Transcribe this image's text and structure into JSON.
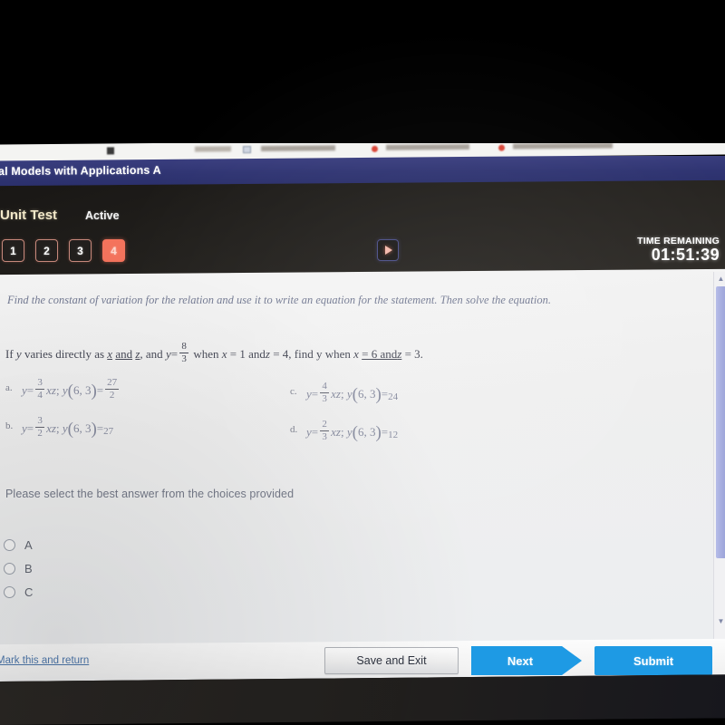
{
  "browser": {
    "bookmarks": [
      {
        "label": "",
        "type": "square"
      },
      {
        "label": "",
        "type": "text"
      },
      {
        "label": "",
        "type": "check"
      },
      {
        "label": "",
        "type": "text"
      },
      {
        "label": "",
        "type": "dot"
      },
      {
        "label": "",
        "type": "text"
      },
      {
        "label": "",
        "type": "dot"
      },
      {
        "label": "",
        "type": "text"
      }
    ]
  },
  "header": {
    "course_title": "al Models with Applications A",
    "assessment_name": "Unit Test",
    "status": "Active",
    "question_buttons": [
      {
        "label": "1",
        "active": false
      },
      {
        "label": "2",
        "active": false
      },
      {
        "label": "3",
        "active": false
      },
      {
        "label": "4",
        "active": true
      }
    ],
    "play_icon": "play-triangle-icon",
    "timer_label": "TIME REMAINING",
    "timer_value": "01:51:39",
    "accent_active": "#f4735c",
    "banner_color": "#2f3472"
  },
  "question": {
    "instructions": "Find the constant of variation for the relation and use it to write an equation for the statement. Then solve the equation.",
    "stem": {
      "lead": "If",
      "y": "y",
      "text1": "varies directly as",
      "x": "x",
      "and_txt": "and",
      "z": "z",
      "comma_and": ", and",
      "eq_y": "y",
      "equals": "=",
      "frac_num": "8",
      "frac_den": "3",
      "when": "when",
      "x2": "x",
      "eq1": "= 1 and",
      "z2": "z",
      "eq2": "= 4,",
      "find": "find y when",
      "x3": "x",
      "eq3": "= 6 and",
      "z3": "z",
      "eq4": "= 3."
    },
    "choices": [
      {
        "letter": "a.",
        "y": "y",
        "equals": "=",
        "coef_num": "3",
        "coef_den": "4",
        "vars": "xz",
        "sep": ";",
        "fn": "y",
        "args": "6, 3",
        "result_eq": "=",
        "result_num": "27",
        "result_den": "2",
        "result_is_fraction": true
      },
      {
        "letter": "b.",
        "y": "y",
        "equals": "=",
        "coef_num": "3",
        "coef_den": "2",
        "vars": "xz",
        "sep": ";",
        "fn": "y",
        "args": "6, 3",
        "result_eq": "=",
        "result": "27",
        "result_is_fraction": false
      },
      {
        "letter": "c.",
        "y": "y",
        "equals": "=",
        "coef_num": "4",
        "coef_den": "3",
        "vars": "xz",
        "sep": ";",
        "fn": "y",
        "args": "6, 3",
        "result_eq": "=",
        "result": "24",
        "result_is_fraction": false
      },
      {
        "letter": "d.",
        "y": "y",
        "equals": "=",
        "coef_num": "2",
        "coef_den": "3",
        "vars": "xz",
        "sep": ";",
        "fn": "y",
        "args": "6, 3",
        "result_eq": "=",
        "result": "12",
        "result_is_fraction": false
      }
    ],
    "select_note": "Please select the best answer from the choices provided",
    "radio_options": [
      {
        "label": "A",
        "selected": false
      },
      {
        "label": "B",
        "selected": false
      },
      {
        "label": "C",
        "selected": false
      }
    ]
  },
  "scrollbar": {
    "up_arrow": "chevron-up-icon",
    "down_arrow": "chevron-down-icon"
  },
  "footer": {
    "mark_link": "Mark this and return",
    "save_exit": "Save and Exit",
    "next": "Next",
    "submit": "Submit",
    "button_blue": "#1e9ae4"
  }
}
